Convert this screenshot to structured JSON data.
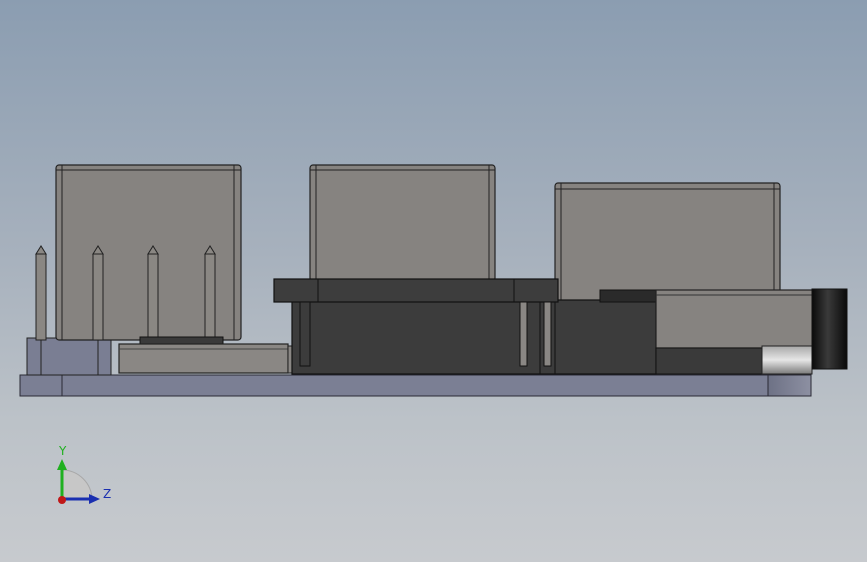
{
  "viewport": {
    "background_top": "#8b9db1",
    "background_bottom": "#c7cace"
  },
  "triad": {
    "y_label": "Y",
    "z_label": "Z",
    "y_color": "#20b020",
    "z_color": "#1a2fb0",
    "x_color": "#c01818"
  },
  "colors": {
    "component_gray": "#878480",
    "board_blue": "#7b7f94",
    "dark_body": "#3a3a3a",
    "black": "#1a1a1a"
  }
}
